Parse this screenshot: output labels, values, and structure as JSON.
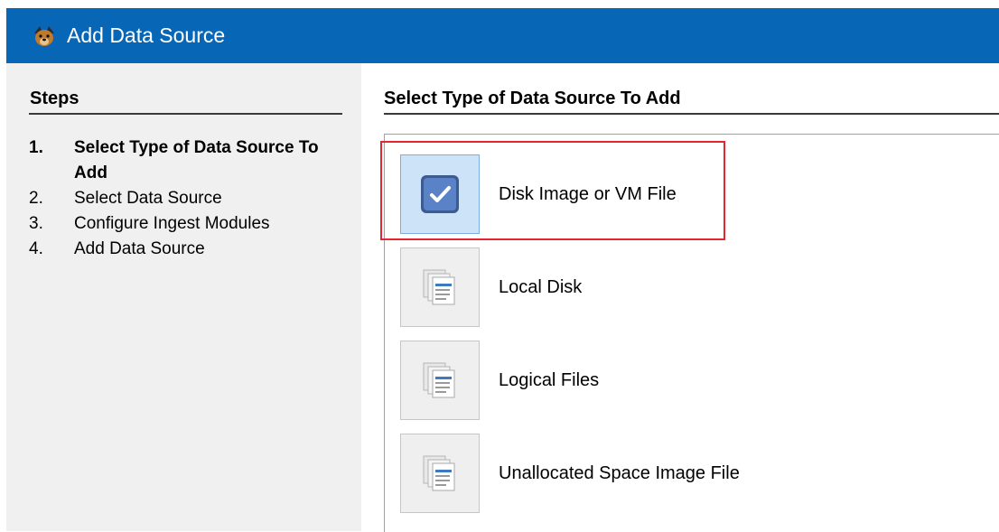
{
  "window": {
    "title": "Add Data Source",
    "app_icon": "autopsy-dog-icon"
  },
  "steps": {
    "header": "Steps",
    "items": [
      {
        "num": "1.",
        "label": "Select Type of Data Source To Add",
        "current": true
      },
      {
        "num": "2.",
        "label": "Select Data Source",
        "current": false
      },
      {
        "num": "3.",
        "label": "Configure Ingest Modules",
        "current": false
      },
      {
        "num": "4.",
        "label": "Add Data Source",
        "current": false
      }
    ]
  },
  "main": {
    "header": "Select Type of Data Source To Add",
    "options": [
      {
        "label": "Disk Image or VM File",
        "icon": "disk-image-icon",
        "selected": true
      },
      {
        "label": "Local Disk",
        "icon": "local-disk-icon",
        "selected": false
      },
      {
        "label": "Logical Files",
        "icon": "logical-files-icon",
        "selected": false
      },
      {
        "label": "Unallocated Space Image File",
        "icon": "unallocated-space-icon",
        "selected": false
      }
    ]
  },
  "colors": {
    "titlebar": "#0767b6",
    "highlight": "#e3262f",
    "selected_button": "#cde3f7"
  }
}
